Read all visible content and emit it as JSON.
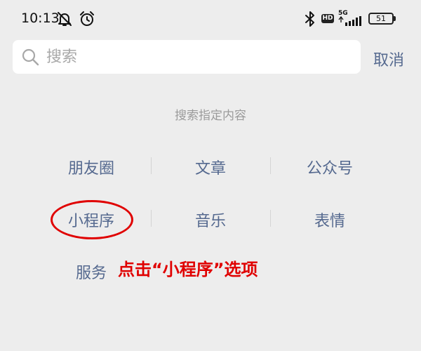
{
  "status_bar": {
    "time": "10:13",
    "network": "5G",
    "hd": "HD",
    "battery": "51",
    "icons": [
      "mute-icon",
      "alarm-icon",
      "bluetooth-icon",
      "signal-icon"
    ]
  },
  "search": {
    "placeholder": "搜索",
    "value": "",
    "cancel_label": "取消"
  },
  "section": {
    "title": "搜索指定内容"
  },
  "options": [
    {
      "label": "朋友圈"
    },
    {
      "label": "文章"
    },
    {
      "label": "公众号"
    },
    {
      "label": "小程序"
    },
    {
      "label": "音乐"
    },
    {
      "label": "表情"
    },
    {
      "label": "服务"
    }
  ],
  "annotation": {
    "text": "点击“小程序”选项",
    "color": "#e00000"
  },
  "colors": {
    "background": "#ededed",
    "link": "#55698f",
    "muted": "#9b9b9b",
    "highlight": "#e00000"
  }
}
